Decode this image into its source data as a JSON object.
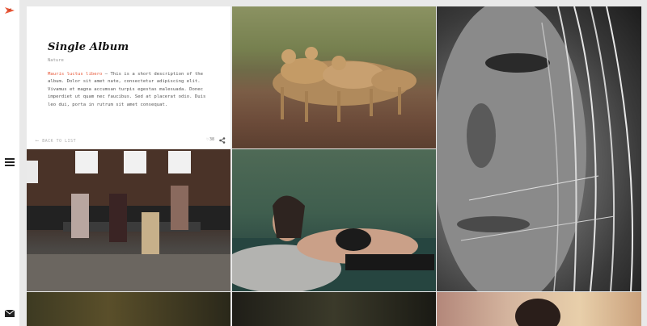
{
  "album": {
    "title": "Single Album",
    "category": "Nature",
    "description_highlight": "Mauris luctus libero",
    "description_body": " – This is a short description of the album. Dolor sit amet nate, consectetur adipiscing elit. Vivamus et magna accumsan turpis egestas malesuada. Donec imperdiet ut quam nec faucibus. Sed at placerat odio. Duis leo dui, porta in rutrum sit amet consequat.",
    "back_label": "BACK TO LIST",
    "likes": "38"
  },
  "icons": {
    "logo": "bird-logo-icon",
    "menu": "hamburger-menu-icon",
    "mail": "envelope-icon",
    "back": "arrow-left-icon",
    "like": "heart-icon",
    "share": "share-icon"
  },
  "colors": {
    "accent": "#e8593a",
    "background": "#e9e9e9",
    "card": "#ffffff"
  }
}
